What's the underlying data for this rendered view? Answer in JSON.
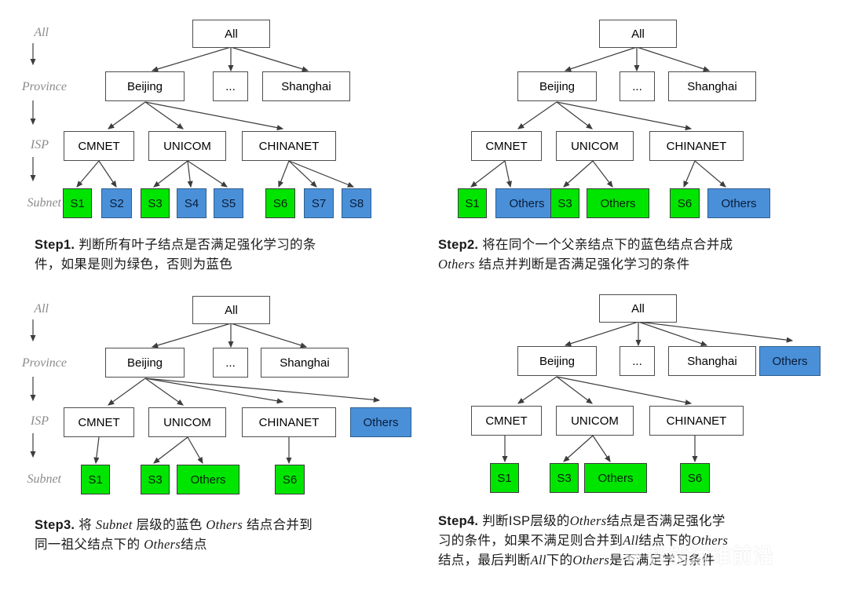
{
  "levels": {
    "all": "All",
    "province": "Province",
    "isp": "ISP",
    "subnet": "Subnet"
  },
  "nodes": {
    "all": "All",
    "beijing": "Beijing",
    "ellipsis": "...",
    "shanghai": "Shanghai",
    "cmnet": "CMNET",
    "unicom": "UNICOM",
    "chinanet": "CHINANET",
    "others": "Others",
    "s1": "S1",
    "s2": "S2",
    "s3": "S3",
    "s4": "S4",
    "s5": "S5",
    "s6": "S6",
    "s7": "S7",
    "s8": "S8"
  },
  "colors": {
    "green": "#00e500",
    "blue": "#4a90d9",
    "box_border": "#4d4d4d",
    "axis_label": "#8c8c8c",
    "arrow": "#3d3d3d"
  },
  "panels": [
    {
      "id": "step1",
      "step_label": "Step1.",
      "caption_line1": "判断所有叶子结点是否满足强化学习的条",
      "caption_line2": "件，如果是则为绿色，否则为蓝色",
      "leaves": [
        {
          "label": "S1",
          "color": "green"
        },
        {
          "label": "S2",
          "color": "blue"
        },
        {
          "label": "S3",
          "color": "green"
        },
        {
          "label": "S4",
          "color": "blue"
        },
        {
          "label": "S5",
          "color": "blue"
        },
        {
          "label": "S6",
          "color": "green"
        },
        {
          "label": "S7",
          "color": "blue"
        },
        {
          "label": "S8",
          "color": "blue"
        }
      ]
    },
    {
      "id": "step2",
      "step_label": "Step2.",
      "caption_line1": "将在同个一个父亲结点下的蓝色结点合并成",
      "caption_line2_italic": "Others",
      "caption_line2_rest": " 结点并判断是否满足强化学习的条件",
      "leaves": [
        {
          "label": "S1",
          "color": "green"
        },
        {
          "label": "Others",
          "color": "blue"
        },
        {
          "label": "S3",
          "color": "green"
        },
        {
          "label": "Others",
          "color": "green"
        },
        {
          "label": "S6",
          "color": "green"
        },
        {
          "label": "Others",
          "color": "blue"
        }
      ]
    },
    {
      "id": "step3",
      "step_label": "Step3.",
      "caption_line1_pre": "将 ",
      "caption_line1_italic1": "Subnet",
      "caption_line1_mid": " 层级的蓝色 ",
      "caption_line1_italic2": "Others",
      "caption_line1_post": " 结点合并到",
      "caption_line2_pre": "同一祖父结点下的 ",
      "caption_line2_italic": "Others",
      "caption_line2_post": "结点",
      "isp_others": {
        "label": "Others",
        "color": "blue"
      },
      "leaves": [
        {
          "label": "S1",
          "color": "green"
        },
        {
          "label": "S3",
          "color": "green"
        },
        {
          "label": "Others",
          "color": "green"
        },
        {
          "label": "S6",
          "color": "green"
        }
      ]
    },
    {
      "id": "step4",
      "step_label": "Step4.",
      "caption_line1_pre": "判断ISP层级的",
      "caption_line1_italic": "Others",
      "caption_line1_post": "结点是否满足强化学",
      "caption_line2_pre": "习的条件，如果不满足则合并到",
      "caption_line2_italic1": "All",
      "caption_line2_mid": "结点下的",
      "caption_line2_italic2": "Others",
      "caption_line3_pre": "结点，最后判断",
      "caption_line3_italic1": "All",
      "caption_line3_mid": "下的",
      "caption_line3_italic2": "Others",
      "caption_line3_post": "是否满足学习条件",
      "province_others": {
        "label": "Others",
        "color": "blue"
      },
      "leaves": [
        {
          "label": "S1",
          "color": "green"
        },
        {
          "label": "S3",
          "color": "green"
        },
        {
          "label": "Others",
          "color": "green"
        },
        {
          "label": "S6",
          "color": "green"
        }
      ]
    }
  ],
  "watermark": {
    "text": "智能运维前沿",
    "mascot": "cat-mascot-icon"
  }
}
